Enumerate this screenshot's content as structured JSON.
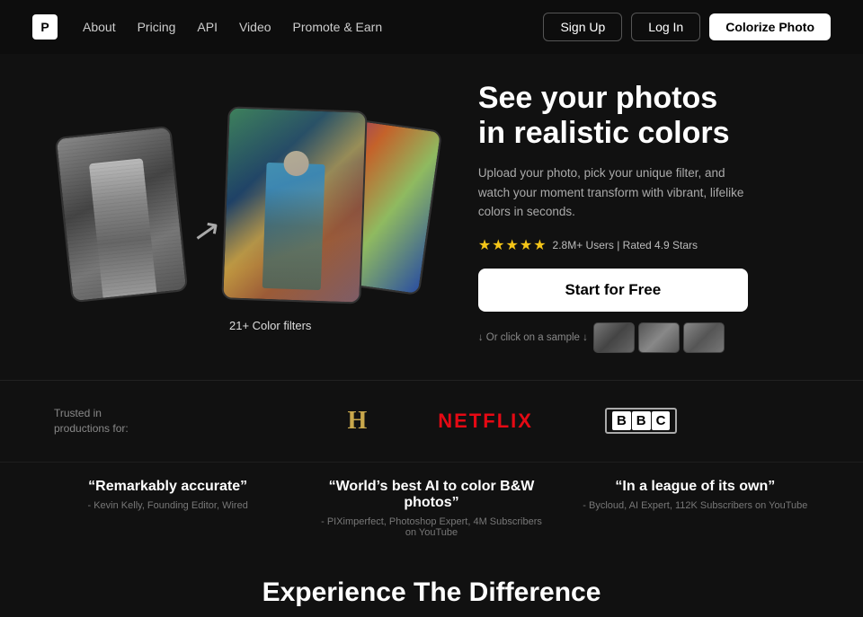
{
  "nav": {
    "logo": "P",
    "links": [
      {
        "label": "About",
        "id": "about"
      },
      {
        "label": "Pricing",
        "id": "pricing"
      },
      {
        "label": "API",
        "id": "api"
      },
      {
        "label": "Video",
        "id": "video"
      },
      {
        "label": "Promote & Earn",
        "id": "promote"
      }
    ],
    "signup_label": "Sign Up",
    "login_label": "Log In",
    "colorize_label": "Colorize Photo"
  },
  "hero": {
    "title": "See your photos\nin realistic colors",
    "subtitle": "Upload your photo, pick your unique filter, and watch your moment transform with vibrant, lifelike colors in seconds.",
    "stars": "★★★★★",
    "rating_text": "2.8M+ Users | Rated 4.9 Stars",
    "cta_label": "Start for Free",
    "sample_text": "↓ Or click on a sample ↓",
    "color_filters_label": "21+ Color filters"
  },
  "trusted": {
    "label": "Trusted in\nproductions for:",
    "logos": [
      {
        "name": "History Channel",
        "display": "H"
      },
      {
        "name": "Netflix",
        "display": "NETFLIX"
      },
      {
        "name": "BBC",
        "display": "BBC"
      }
    ]
  },
  "testimonials": [
    {
      "quote": "“Remarkably accurate”",
      "author": "- Kevin Kelly, Founding Editor, Wired"
    },
    {
      "quote": "“World’s best AI to color B&W photos”",
      "author": "- PIXimperfect, Photoshop Expert, 4M Subscribers on YouTube"
    },
    {
      "quote": "“In a league of its own”",
      "author": "- Bycloud, AI Expert, 112K Subscribers on YouTube"
    }
  ],
  "bottom": {
    "heading": "Experience The Difference"
  }
}
